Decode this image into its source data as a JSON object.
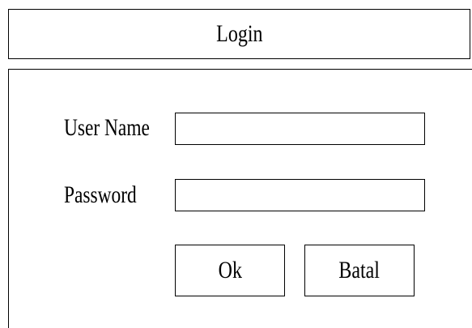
{
  "header": {
    "title": "Login"
  },
  "form": {
    "username_label": "User Name",
    "username_value": "",
    "password_label": "Password",
    "password_value": "",
    "ok_label": "Ok",
    "cancel_label": "Batal"
  }
}
